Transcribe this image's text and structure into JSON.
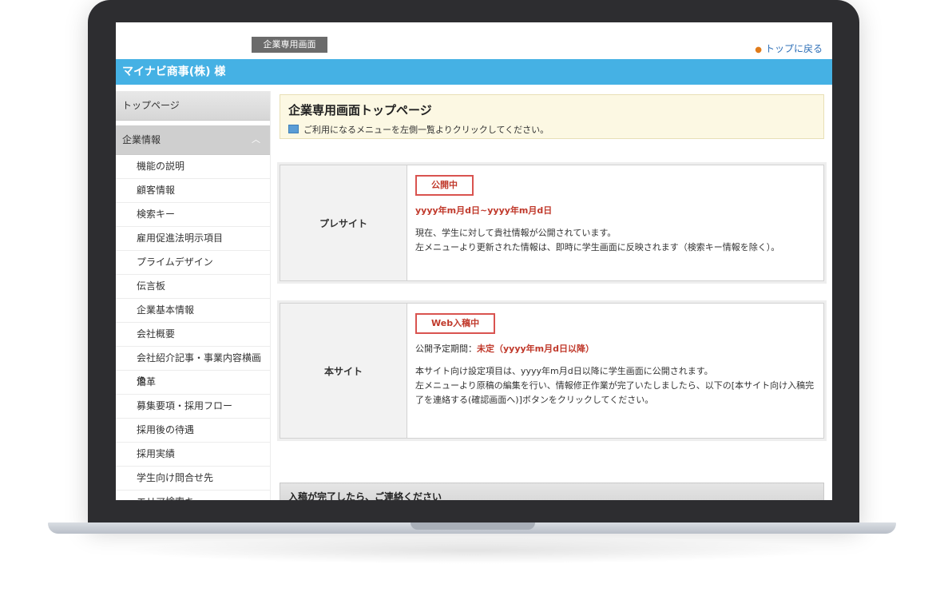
{
  "header": {
    "screen_badge": "企業専用画面",
    "back_link": "トップに戻る"
  },
  "company": {
    "name": "マイナビ商事(株)  様"
  },
  "sidebar": {
    "top_page": "トップページ",
    "section_title": "企業情報",
    "items": [
      {
        "label": "機能の説明"
      },
      {
        "label": "顧客情報"
      },
      {
        "label": "検索キー"
      },
      {
        "label": "雇用促進法明示項目"
      },
      {
        "label": "プライムデザイン"
      },
      {
        "label": "伝言板"
      },
      {
        "label": "企業基本情報"
      },
      {
        "label": "会社概要"
      },
      {
        "label": "会社紹介記事・事業内容横画像"
      },
      {
        "label": "沿革"
      },
      {
        "label": "募集要項・採用フロー"
      },
      {
        "label": "採用後の待遇"
      },
      {
        "label": "採用実績"
      },
      {
        "label": "学生向け問合せ先"
      },
      {
        "label": "エリア検索キー"
      }
    ]
  },
  "main": {
    "title": "企業専用画面トップページ",
    "subtitle": "ご利用になるメニューを左側一覧よりクリックしてください。",
    "pre_site": {
      "label": "プレサイト",
      "status": "公開中",
      "period": "yyyy年m月d日~yyyy年m月d日",
      "desc1": "現在、学生に対して貴社情報が公開されています。",
      "desc2": "左メニューより更新された情報は、即時に学生画面に反映されます（検索キー情報を除く）。"
    },
    "main_site": {
      "label": "本サイト",
      "status": "Web入稿中",
      "period_label": "公開予定期間：",
      "period_value": "未定（yyyy年m月d日以降）",
      "desc1": "本サイト向け設定項目は、yyyy年m月d日以降に学生画面に公開されます。",
      "desc2": "左メニューより原稿の編集を行い、情報修正作業が完了いたしましたら、以下の[本サイト向け入稿完了を連絡する(確認画面へ)]ボタンをクリックしてください。"
    },
    "notice_title": "入稿が完了したら、ご連絡ください"
  },
  "colors": {
    "company_bar": "#45b1e4",
    "status_red": "#c0392b",
    "intro_bg": "#fcf8e3",
    "link_blue": "#2e6fb7"
  }
}
